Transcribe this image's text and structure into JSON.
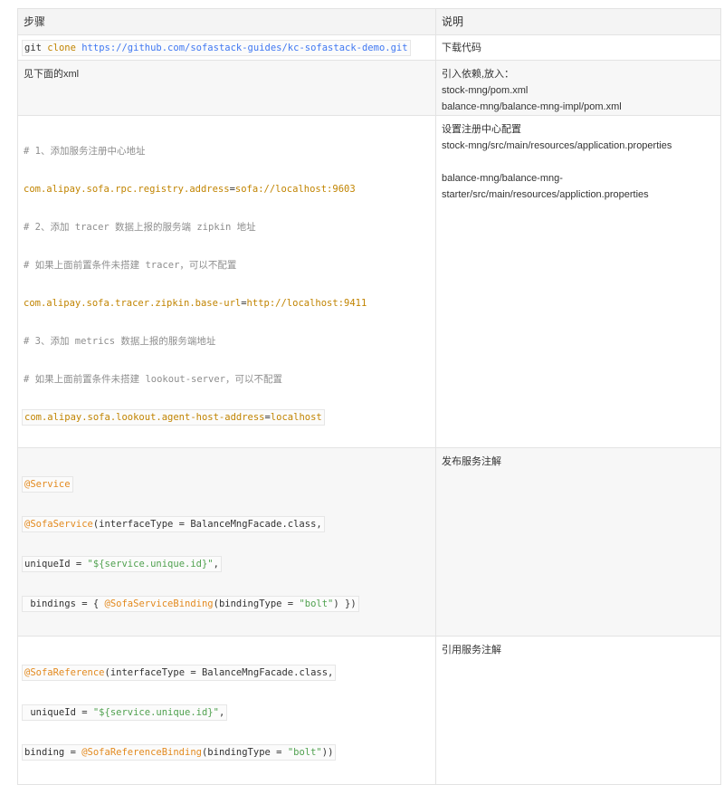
{
  "header": {
    "col_step": "步骤",
    "col_desc": "说明"
  },
  "rows": [
    {
      "step": {
        "git": "git",
        "clone": "clone",
        "url": "https://github.com/sofastack-guides/kc-sofastack-demo.git"
      },
      "desc": [
        "下载代码"
      ]
    },
    {
      "step_text": "见下面的xml",
      "desc": [
        "引入依赖,放入：",
        "stock-mng/pom.xml",
        "balance-mng/balance-mng-impl/pom.xml"
      ]
    },
    {
      "step_lines": [
        {
          "type": "comment",
          "text": "# 1、添加服务注册中心地址"
        },
        {
          "type": "prop",
          "key": "com.alipay.sofa.rpc.registry.address",
          "eq": "=",
          "value": "sofa://localhost:9603"
        },
        {
          "type": "comment",
          "text": "# 2、添加 tracer 数据上报的服务端 zipkin 地址"
        },
        {
          "type": "comment",
          "text": "# 如果上面前置条件未搭建 tracer，可以不配置"
        },
        {
          "type": "prop",
          "key": "com.alipay.sofa.tracer.zipkin.base-url",
          "eq": "=",
          "value": "http://localhost:9411"
        },
        {
          "type": "comment",
          "text": "# 3、添加 metrics 数据上报的服务端地址"
        },
        {
          "type": "comment",
          "text": "# 如果上面前置条件未搭建 lookout-server，可以不配置"
        },
        {
          "type": "prop",
          "key": "com.alipay.sofa.lookout.agent-host-address",
          "eq": "=",
          "value": "localhost"
        }
      ],
      "desc": [
        "设置注册中心配置",
        "stock-mng/src/main/resources/application.properties",
        "",
        "balance-mng/balance-mng-",
        "starter/src/main/resources/appliction.properties"
      ]
    },
    {
      "code": {
        "l1": "@Service",
        "l2_ann": "@SofaService",
        "l2_rest": "(interfaceType = BalanceMngFacade.class,",
        "l3_a": "uniqueId = ",
        "l3_str": "\"${service.unique.id}\"",
        "l3_b": ",",
        "l4_a": " bindings = { ",
        "l4_ann": "@SofaServiceBinding",
        "l4_b": "(bindingType = ",
        "l4_str": "\"bolt\"",
        "l4_c": ") })"
      },
      "desc": [
        "发布服务注解"
      ]
    },
    {
      "code": {
        "l1_ann": "@SofaReference",
        "l1_rest": "(interfaceType = BalanceMngFacade.class,",
        "l2_a": " uniqueId = ",
        "l2_str": "\"${service.unique.id}\"",
        "l2_b": ",",
        "l3_a": "binding = ",
        "l3_ann": "@SofaReferenceBinding",
        "l3_b": "(bindingType = ",
        "l3_str": "\"bolt\"",
        "l3_c": "))"
      },
      "desc": [
        "引用服务注解"
      ]
    }
  ]
}
